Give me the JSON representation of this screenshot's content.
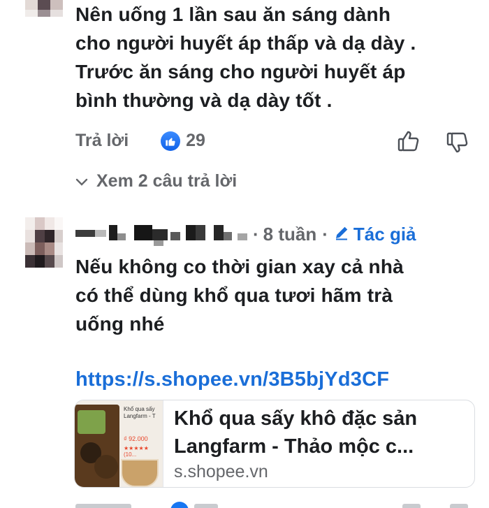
{
  "comment1": {
    "text_lines": [
      "Nên uống  1 lần sau ăn sáng dành",
      "cho người huyết áp thấp và dạ dày .",
      "Trước ăn sáng cho người huyết áp",
      "bình thường và dạ dày tốt ."
    ],
    "reply_label": "Trả lời",
    "reaction_count": "29",
    "reaction_icon": "like-icon",
    "view_replies_label": "Xem 2 câu trả lời"
  },
  "comment2": {
    "time": "8 tuần",
    "dot": "·",
    "author_badge": "Tác giả",
    "text_lines": [
      "Nếu không co thời gian xay cả nhà",
      "có thể dùng khổ qua tươi hãm trà",
      "uống nhé"
    ],
    "link": "https://s.shopee.vn/3B5bjYd3CF",
    "preview": {
      "title_line1": "Khổ qua sấy khô đặc sản",
      "title_line2": "Langfarm - Thảo mộc c...",
      "domain": "s.shopee.vn",
      "thumb_title": "Khổ qua sấy Langfarm - T",
      "thumb_price": "₫ 92.000",
      "thumb_rating": "★★★★★ (10..."
    }
  },
  "colors": {
    "link": "#1a6ed8",
    "secondary_text": "#65676b",
    "primary_text": "#1c1e21",
    "like_blue": "#1877f2"
  }
}
